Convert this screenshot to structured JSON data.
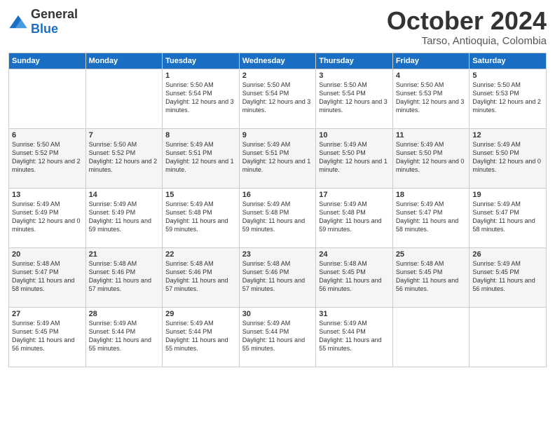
{
  "header": {
    "logo": {
      "general": "General",
      "blue": "Blue"
    },
    "month": "October 2024",
    "location": "Tarso, Antioquia, Colombia"
  },
  "weekdays": [
    "Sunday",
    "Monday",
    "Tuesday",
    "Wednesday",
    "Thursday",
    "Friday",
    "Saturday"
  ],
  "weeks": [
    [
      {
        "day": "",
        "info": ""
      },
      {
        "day": "",
        "info": ""
      },
      {
        "day": "1",
        "info": "Sunrise: 5:50 AM\nSunset: 5:54 PM\nDaylight: 12 hours and 3 minutes."
      },
      {
        "day": "2",
        "info": "Sunrise: 5:50 AM\nSunset: 5:54 PM\nDaylight: 12 hours and 3 minutes."
      },
      {
        "day": "3",
        "info": "Sunrise: 5:50 AM\nSunset: 5:54 PM\nDaylight: 12 hours and 3 minutes."
      },
      {
        "day": "4",
        "info": "Sunrise: 5:50 AM\nSunset: 5:53 PM\nDaylight: 12 hours and 3 minutes."
      },
      {
        "day": "5",
        "info": "Sunrise: 5:50 AM\nSunset: 5:53 PM\nDaylight: 12 hours and 2 minutes."
      }
    ],
    [
      {
        "day": "6",
        "info": "Sunrise: 5:50 AM\nSunset: 5:52 PM\nDaylight: 12 hours and 2 minutes."
      },
      {
        "day": "7",
        "info": "Sunrise: 5:50 AM\nSunset: 5:52 PM\nDaylight: 12 hours and 2 minutes."
      },
      {
        "day": "8",
        "info": "Sunrise: 5:49 AM\nSunset: 5:51 PM\nDaylight: 12 hours and 1 minute."
      },
      {
        "day": "9",
        "info": "Sunrise: 5:49 AM\nSunset: 5:51 PM\nDaylight: 12 hours and 1 minute."
      },
      {
        "day": "10",
        "info": "Sunrise: 5:49 AM\nSunset: 5:50 PM\nDaylight: 12 hours and 1 minute."
      },
      {
        "day": "11",
        "info": "Sunrise: 5:49 AM\nSunset: 5:50 PM\nDaylight: 12 hours and 0 minutes."
      },
      {
        "day": "12",
        "info": "Sunrise: 5:49 AM\nSunset: 5:50 PM\nDaylight: 12 hours and 0 minutes."
      }
    ],
    [
      {
        "day": "13",
        "info": "Sunrise: 5:49 AM\nSunset: 5:49 PM\nDaylight: 12 hours and 0 minutes."
      },
      {
        "day": "14",
        "info": "Sunrise: 5:49 AM\nSunset: 5:49 PM\nDaylight: 11 hours and 59 minutes."
      },
      {
        "day": "15",
        "info": "Sunrise: 5:49 AM\nSunset: 5:48 PM\nDaylight: 11 hours and 59 minutes."
      },
      {
        "day": "16",
        "info": "Sunrise: 5:49 AM\nSunset: 5:48 PM\nDaylight: 11 hours and 59 minutes."
      },
      {
        "day": "17",
        "info": "Sunrise: 5:49 AM\nSunset: 5:48 PM\nDaylight: 11 hours and 59 minutes."
      },
      {
        "day": "18",
        "info": "Sunrise: 5:49 AM\nSunset: 5:47 PM\nDaylight: 11 hours and 58 minutes."
      },
      {
        "day": "19",
        "info": "Sunrise: 5:49 AM\nSunset: 5:47 PM\nDaylight: 11 hours and 58 minutes."
      }
    ],
    [
      {
        "day": "20",
        "info": "Sunrise: 5:48 AM\nSunset: 5:47 PM\nDaylight: 11 hours and 58 minutes."
      },
      {
        "day": "21",
        "info": "Sunrise: 5:48 AM\nSunset: 5:46 PM\nDaylight: 11 hours and 57 minutes."
      },
      {
        "day": "22",
        "info": "Sunrise: 5:48 AM\nSunset: 5:46 PM\nDaylight: 11 hours and 57 minutes."
      },
      {
        "day": "23",
        "info": "Sunrise: 5:48 AM\nSunset: 5:46 PM\nDaylight: 11 hours and 57 minutes."
      },
      {
        "day": "24",
        "info": "Sunrise: 5:48 AM\nSunset: 5:45 PM\nDaylight: 11 hours and 56 minutes."
      },
      {
        "day": "25",
        "info": "Sunrise: 5:48 AM\nSunset: 5:45 PM\nDaylight: 11 hours and 56 minutes."
      },
      {
        "day": "26",
        "info": "Sunrise: 5:49 AM\nSunset: 5:45 PM\nDaylight: 11 hours and 56 minutes."
      }
    ],
    [
      {
        "day": "27",
        "info": "Sunrise: 5:49 AM\nSunset: 5:45 PM\nDaylight: 11 hours and 56 minutes."
      },
      {
        "day": "28",
        "info": "Sunrise: 5:49 AM\nSunset: 5:44 PM\nDaylight: 11 hours and 55 minutes."
      },
      {
        "day": "29",
        "info": "Sunrise: 5:49 AM\nSunset: 5:44 PM\nDaylight: 11 hours and 55 minutes."
      },
      {
        "day": "30",
        "info": "Sunrise: 5:49 AM\nSunset: 5:44 PM\nDaylight: 11 hours and 55 minutes."
      },
      {
        "day": "31",
        "info": "Sunrise: 5:49 AM\nSunset: 5:44 PM\nDaylight: 11 hours and 55 minutes."
      },
      {
        "day": "",
        "info": ""
      },
      {
        "day": "",
        "info": ""
      }
    ]
  ]
}
